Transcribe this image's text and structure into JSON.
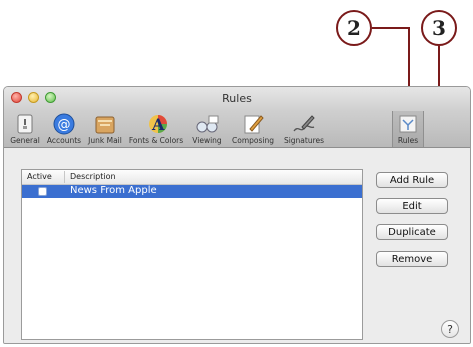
{
  "callouts": {
    "two": "2",
    "three": "3"
  },
  "window": {
    "title": "Rules"
  },
  "toolbar": {
    "items": [
      {
        "label": "General",
        "icon": "general-switch-icon"
      },
      {
        "label": "Accounts",
        "icon": "at-sign-icon"
      },
      {
        "label": "Junk Mail",
        "icon": "junk-mail-icon"
      },
      {
        "label": "Fonts & Colors",
        "icon": "fonts-colors-icon"
      },
      {
        "label": "Viewing",
        "icon": "glasses-icon"
      },
      {
        "label": "Composing",
        "icon": "composing-pencil-icon"
      },
      {
        "label": "Signatures",
        "icon": "signature-pen-icon"
      },
      {
        "label": "Rules",
        "icon": "rules-mail-icon"
      }
    ],
    "selected": "Rules"
  },
  "table": {
    "headers": {
      "active": "Active",
      "description": "Description"
    },
    "rows": [
      {
        "active": false,
        "description": "News From Apple",
        "selected": true
      }
    ]
  },
  "buttons": {
    "add_rule": "Add Rule",
    "edit": "Edit",
    "duplicate": "Duplicate",
    "remove": "Remove"
  },
  "help": {
    "label": "?"
  },
  "colors": {
    "selection": "#3b6fd0",
    "callout_line": "#7a1a1a"
  }
}
